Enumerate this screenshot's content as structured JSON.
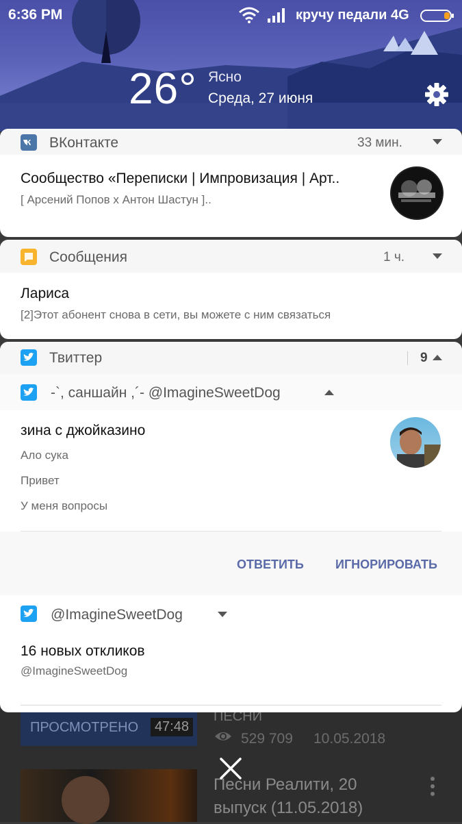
{
  "status_bar": {
    "time": "6:36 PM",
    "carrier": "кручу педали 4G",
    "battery_level": 0.2
  },
  "weather": {
    "temperature": "26°",
    "condition": "Ясно",
    "date": "Среда, 27 июня"
  },
  "notifications": {
    "vk": {
      "app_name": "ВКонтакте",
      "time": "33 мин.",
      "title": "Сообщество «Переписки | Импровизация | Арт..",
      "text": "[ Арсений Попов х Антон Шастун ].."
    },
    "sms": {
      "app_name": "Сообщения",
      "time": "1 ч.",
      "title": "Лариса",
      "text": "[2]Этот абонент снова в сети, вы можете с ним связаться"
    },
    "twitter": {
      "app_name": "Твиттер",
      "count": "9",
      "thread1": {
        "header": "-`, саншайн ,´- @ImagineSweetDog",
        "title": "зина с джойказино",
        "lines": [
          "Ало сука",
          "Привет",
          "У меня вопросы"
        ],
        "reply_label": "ОТВЕТИТЬ",
        "ignore_label": "ИГНОРИРОВАТЬ"
      },
      "thread2": {
        "header": "@ImagineSweetDog",
        "title": "16 новых откликов",
        "text": "@ImagineSweetDog"
      }
    }
  },
  "background": {
    "watched_label": "ПРОСМОТРЕНО",
    "duration": "47:48",
    "partial_title": "ПЕСНИ",
    "views": "529 709",
    "upload_date": "10.05.2018",
    "video2_title": "Песни Реалити, 20 выпуск (11.05.2018)"
  },
  "colors": {
    "accent_button": "#5a6aa8",
    "vk_blue": "#4a76a8",
    "twitter_blue": "#1da1f2",
    "sms_orange": "#f7b42c"
  }
}
